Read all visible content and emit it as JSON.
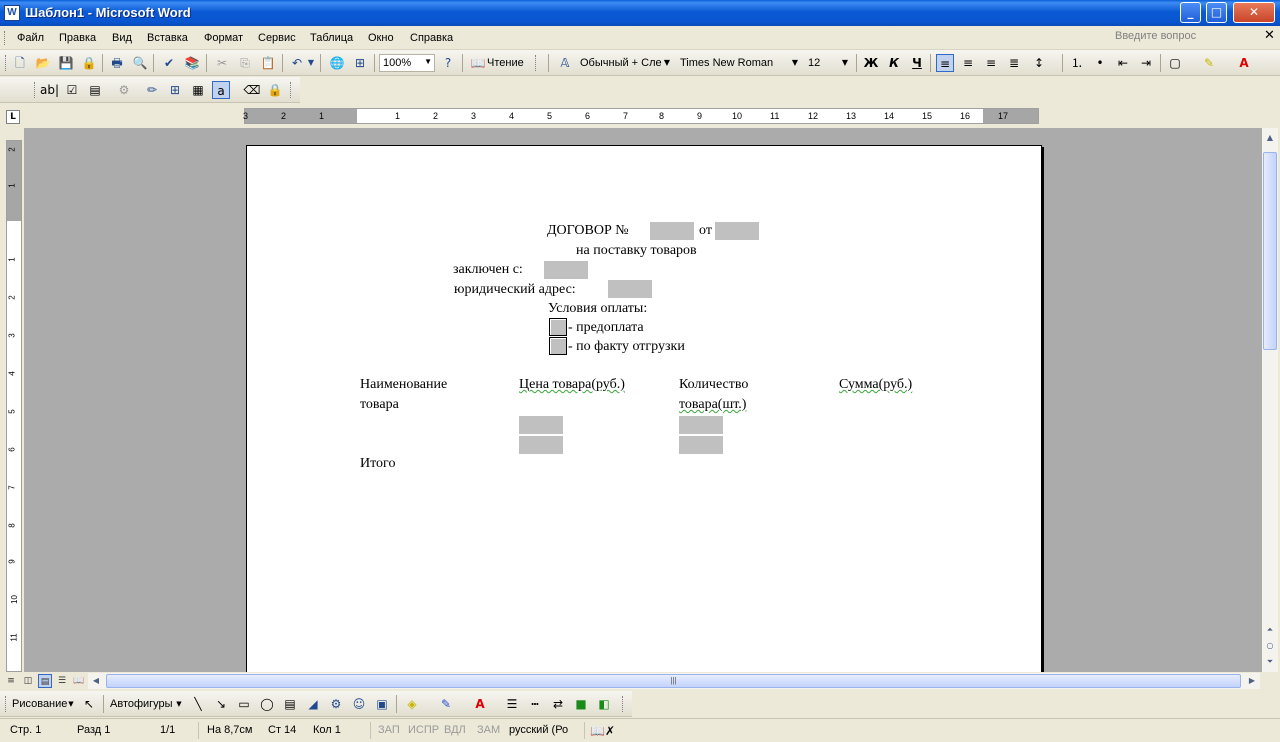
{
  "window": {
    "title": "Шаблон1 - Microsoft Word",
    "app_icon": "W",
    "minimize": "_",
    "maximize": "□",
    "close": "✕"
  },
  "menu": {
    "items": [
      "Файл",
      "Правка",
      "Вид",
      "Вставка",
      "Формат",
      "Сервис",
      "Таблица",
      "Окно",
      "Справка"
    ],
    "help_placeholder": "Введите вопрос",
    "doc_close": "✕"
  },
  "toolbar": {
    "zoom": "100%",
    "reading_label": "Чтение",
    "style": "Обычный + Сле",
    "font": "Times New Roman",
    "font_size": "12",
    "bold": "Ж",
    "italic": "К",
    "underline": "Ч"
  },
  "forms_toolbar": {
    "text_field": "ab|"
  },
  "ruler": {
    "numbers": [
      "3",
      "2",
      "1",
      "1",
      "2",
      "3",
      "4",
      "5",
      "6",
      "7",
      "8",
      "9",
      "10",
      "11",
      "12",
      "13",
      "14",
      "15",
      "16",
      "17"
    ],
    "tab_selector": "L",
    "vertical_numbers": [
      "2",
      "1",
      "1",
      "2",
      "3",
      "4",
      "5",
      "6",
      "7",
      "8",
      "9",
      "10",
      "11"
    ]
  },
  "document": {
    "title_prefix": "ДОГОВОР №",
    "title_from": "от",
    "subtitle": "на поставку товаров",
    "concluded_with": "заключен с:",
    "legal_address": "юридический адрес:",
    "payment_terms": "Условия оплаты:",
    "options": [
      "- предоплата",
      "- по факту отгрузки"
    ],
    "columns": [
      {
        "line1": "Наименование",
        "line2": "товара"
      },
      {
        "line1": "Цена товара(руб.)",
        "line2": ""
      },
      {
        "line1": "Количество",
        "line2": "товара(шт.)"
      },
      {
        "line1": "Сумма(руб.)",
        "line2": ""
      }
    ],
    "total": "Итого"
  },
  "draw_toolbar": {
    "drawing": "Рисование",
    "autoshapes": "Автофигуры"
  },
  "status": {
    "page": "Стр. 1",
    "section": "Разд 1",
    "pages": "1/1",
    "at": "На 8,7см",
    "line": "Ст 14",
    "col": "Кол 1",
    "rec": "ЗАП",
    "trk": "ИСПР",
    "ext": "ВДЛ",
    "ovr": "ЗАМ",
    "lang": "русский (Ро"
  },
  "colors": {
    "titlebar": "#0a5fd8",
    "field_shading": "#c0c0c0",
    "doc_background": "#ababab"
  }
}
